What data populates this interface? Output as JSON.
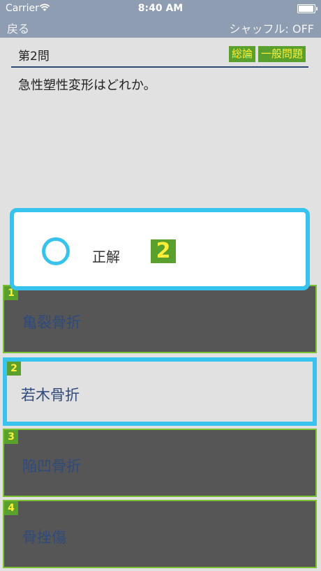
{
  "status": {
    "carrier": "Carrier",
    "time": "8:40 AM"
  },
  "nav": {
    "back_label": "戻る",
    "shuffle_label": "シャッフル: OFF"
  },
  "question": {
    "number_label": "第2問",
    "tags": [
      "総論",
      "一般問題"
    ],
    "text": "急性塑性変形はどれか。"
  },
  "result": {
    "label": "正解",
    "answer": "2",
    "mark": "○"
  },
  "choices": [
    {
      "num": "1",
      "text": "亀裂骨折",
      "selected": false
    },
    {
      "num": "2",
      "text": "若木骨折",
      "selected": true
    },
    {
      "num": "3",
      "text": "陥凹骨折",
      "selected": false
    },
    {
      "num": "4",
      "text": "骨挫傷",
      "selected": false
    }
  ],
  "colors": {
    "nav": "#8e9db2",
    "accent": "#37c3ee",
    "tag": "#5aa02c",
    "tag_text": "#ffef3a",
    "choice_bg": "#565656"
  }
}
